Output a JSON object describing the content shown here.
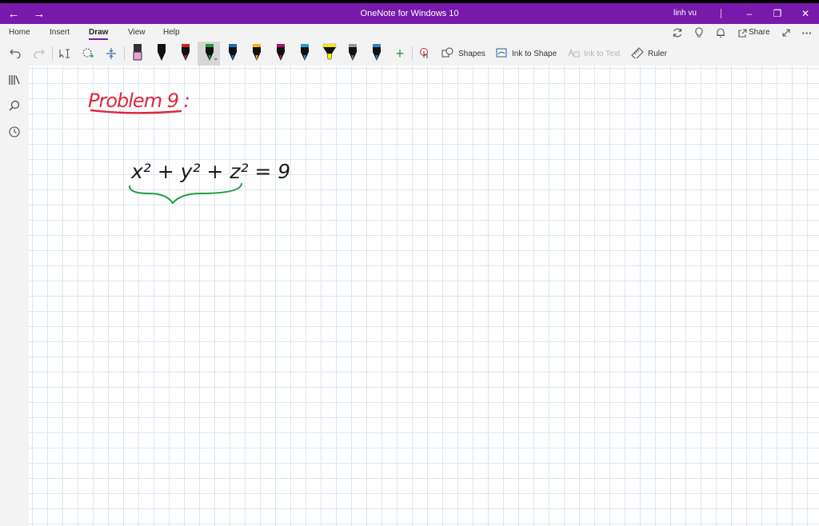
{
  "window": {
    "title": "OneNote for Windows 10",
    "user": "linh vu"
  },
  "ribbon": {
    "tabs": [
      {
        "label": "Home"
      },
      {
        "label": "Insert"
      },
      {
        "label": "Draw",
        "active": true
      },
      {
        "label": "View"
      },
      {
        "label": "Help"
      }
    ],
    "share_label": "Share",
    "tools": {
      "shapes_label": "Shapes",
      "ink_to_shape_label": "Ink to Shape",
      "ink_to_text_label": "Ink to Text",
      "ruler_label": "Ruler"
    },
    "pens": [
      {
        "color": "#e6a3d6",
        "type": "highlighter"
      },
      {
        "color": "#111111",
        "type": "pen"
      },
      {
        "color": "#d42027",
        "type": "pen"
      },
      {
        "color": "#1e9a3a",
        "type": "pen",
        "selected": true
      },
      {
        "color": "#1a6fb8",
        "type": "pen"
      },
      {
        "color": "#f5b300",
        "type": "pen"
      },
      {
        "color": "#b0126a",
        "type": "pen"
      },
      {
        "color": "#19a3d8",
        "type": "pen"
      },
      {
        "color": "#fff000",
        "type": "highlighter"
      },
      {
        "color": "#777777",
        "type": "pencil"
      },
      {
        "color": "#2f83c5",
        "type": "pen"
      }
    ]
  },
  "ink": {
    "heading": "Problem 9 :",
    "equation": "x² + y² + z² = 9",
    "heading_color": "#e0273a",
    "equation_color": "#1a1a1a",
    "brace_color": "#1e9a3a"
  },
  "colors": {
    "accent": "#7719aa",
    "ribbon_bg": "#f3f3f3",
    "grid_line": "#dbe7f0"
  }
}
